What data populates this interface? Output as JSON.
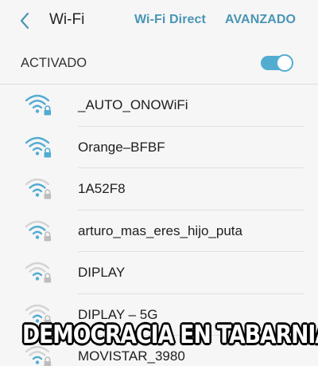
{
  "header": {
    "back_icon": "chevron-left-icon",
    "title": "Wi-Fi",
    "wifi_direct": "Wi-Fi Direct",
    "advanced": "AVANZADO"
  },
  "toggle": {
    "label": "ACTIVADO",
    "state": "on",
    "color": "#52acd2"
  },
  "accent_color": "#4a95b5",
  "networks": [
    {
      "name": "_AUTO_ONOWiFi",
      "signal": 4,
      "secured": true
    },
    {
      "name": "Orange–BFBF",
      "signal": 4,
      "secured": true
    },
    {
      "name": "1A52F8",
      "signal": 3,
      "secured": true
    },
    {
      "name": "arturo_mas_eres_hijo_puta",
      "signal": 3,
      "secured": true
    },
    {
      "name": "DIPLAY",
      "signal": 2,
      "secured": true
    },
    {
      "name": "DIPLAY – 5G",
      "signal": 2,
      "secured": true
    },
    {
      "name": "MOVISTAR_3980",
      "signal": 2,
      "secured": true
    }
  ],
  "caption": "DEMOCRACIA EN TABARNIA"
}
